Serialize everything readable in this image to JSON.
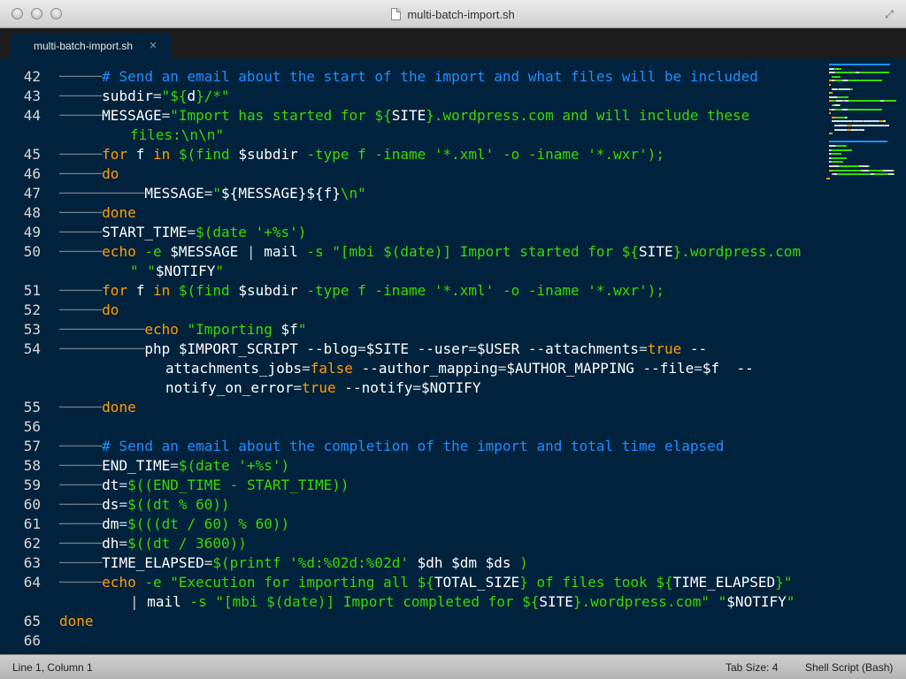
{
  "window": {
    "title": "multi-batch-import.sh"
  },
  "tabs": [
    {
      "label": "multi-batch-import.sh",
      "close_glyph": "×"
    }
  ],
  "editor": {
    "lines": [
      {
        "n": "42",
        "indent": 1,
        "wrap": false,
        "tokens": [
          [
            "c-cmt",
            "# Send an email about the start of the import and what files will be included"
          ]
        ]
      },
      {
        "n": "43",
        "indent": 1,
        "wrap": false,
        "tokens": [
          [
            "c-var",
            "subdir"
          ],
          [
            "c-op",
            "="
          ],
          [
            "c-str",
            "\"${"
          ],
          [
            "c-var",
            "d"
          ],
          [
            "c-str",
            "}/*\""
          ]
        ]
      },
      {
        "n": "44",
        "indent": 1,
        "wrap": false,
        "tokens": [
          [
            "c-var",
            "MESSAGE"
          ],
          [
            "c-op",
            "="
          ],
          [
            "c-str",
            "\"Import has started for ${"
          ],
          [
            "c-var",
            "SITE"
          ],
          [
            "c-str",
            "}.wordpress.com and will include these"
          ]
        ]
      },
      {
        "n": "",
        "indent": 2,
        "wrap": true,
        "tokens": [
          [
            "c-str",
            "files:\\n\\n\""
          ]
        ]
      },
      {
        "n": "45",
        "indent": 1,
        "wrap": false,
        "tokens": [
          [
            "c-kw",
            "for"
          ],
          [
            "c-var",
            " f "
          ],
          [
            "c-kw",
            "in"
          ],
          [
            "c-str",
            " $(find "
          ],
          [
            "c-var",
            "$subdir"
          ],
          [
            "c-str",
            " -type f -iname '*.xml' -o -iname '*.wxr');"
          ]
        ]
      },
      {
        "n": "46",
        "indent": 1,
        "wrap": false,
        "tokens": [
          [
            "c-kw",
            "do"
          ]
        ]
      },
      {
        "n": "47",
        "indent": 2,
        "wrap": false,
        "tokens": [
          [
            "c-var",
            "MESSAGE"
          ],
          [
            "c-op",
            "="
          ],
          [
            "c-str",
            "\""
          ],
          [
            "c-var",
            "${MESSAGE}${f}"
          ],
          [
            "c-str",
            "\\n\""
          ]
        ]
      },
      {
        "n": "48",
        "indent": 1,
        "wrap": false,
        "tokens": [
          [
            "c-kw",
            "done"
          ]
        ]
      },
      {
        "n": "49",
        "indent": 1,
        "wrap": false,
        "tokens": [
          [
            "c-var",
            "START_TIME"
          ],
          [
            "c-op",
            "="
          ],
          [
            "c-str",
            "$(date '+%s')"
          ]
        ]
      },
      {
        "n": "50",
        "indent": 1,
        "wrap": false,
        "tokens": [
          [
            "c-kw",
            "echo"
          ],
          [
            "c-str",
            " -e "
          ],
          [
            "c-var",
            "$MESSAGE"
          ],
          [
            "c-op",
            " | "
          ],
          [
            "c-var",
            "mail"
          ],
          [
            "c-str",
            " -s \"[mbi $(date)] Import started for ${"
          ],
          [
            "c-var",
            "SITE"
          ],
          [
            "c-str",
            "}.wordpress.com"
          ]
        ]
      },
      {
        "n": "",
        "indent": 2,
        "wrap": true,
        "tokens": [
          [
            "c-str",
            "\" \""
          ],
          [
            "c-var",
            "$NOTIFY"
          ],
          [
            "c-str",
            "\""
          ]
        ]
      },
      {
        "n": "51",
        "indent": 1,
        "wrap": false,
        "tokens": [
          [
            "c-kw",
            "for"
          ],
          [
            "c-var",
            " f "
          ],
          [
            "c-kw",
            "in"
          ],
          [
            "c-str",
            " $(find "
          ],
          [
            "c-var",
            "$subdir"
          ],
          [
            "c-str",
            " -type f -iname '*.xml' -o -iname '*.wxr');"
          ]
        ]
      },
      {
        "n": "52",
        "indent": 1,
        "wrap": false,
        "tokens": [
          [
            "c-kw",
            "do"
          ]
        ]
      },
      {
        "n": "53",
        "indent": 2,
        "wrap": false,
        "tokens": [
          [
            "c-kw",
            "echo"
          ],
          [
            "c-str",
            " \"Importing "
          ],
          [
            "c-var",
            "$f"
          ],
          [
            "c-str",
            "\""
          ]
        ]
      },
      {
        "n": "54",
        "indent": 2,
        "wrap": false,
        "tokens": [
          [
            "c-var",
            "php $IMPORT_SCRIPT --blog"
          ],
          [
            "c-op",
            "="
          ],
          [
            "c-var",
            "$SITE --user"
          ],
          [
            "c-op",
            "="
          ],
          [
            "c-var",
            "$USER --attachments"
          ],
          [
            "c-op",
            "="
          ],
          [
            "c-bool",
            "true"
          ],
          [
            "c-var",
            " --"
          ]
        ]
      },
      {
        "n": "",
        "indent": 3,
        "wrap": true,
        "tokens": [
          [
            "c-var",
            "attachments_jobs"
          ],
          [
            "c-op",
            "="
          ],
          [
            "c-bool",
            "false"
          ],
          [
            "c-var",
            " --author_mapping"
          ],
          [
            "c-op",
            "="
          ],
          [
            "c-var",
            "$AUTHOR_MAPPING --file"
          ],
          [
            "c-op",
            "="
          ],
          [
            "c-var",
            "$f  --"
          ]
        ]
      },
      {
        "n": "",
        "indent": 3,
        "wrap": true,
        "tokens": [
          [
            "c-var",
            "notify_on_error"
          ],
          [
            "c-op",
            "="
          ],
          [
            "c-bool",
            "true"
          ],
          [
            "c-var",
            " --notify"
          ],
          [
            "c-op",
            "="
          ],
          [
            "c-var",
            "$NOTIFY"
          ]
        ]
      },
      {
        "n": "55",
        "indent": 1,
        "wrap": false,
        "tokens": [
          [
            "c-kw",
            "done"
          ]
        ]
      },
      {
        "n": "56",
        "indent": 0,
        "wrap": false,
        "tokens": []
      },
      {
        "n": "57",
        "indent": 1,
        "wrap": false,
        "tokens": [
          [
            "c-cmt",
            "# Send an email about the completion of the import and total time elapsed"
          ]
        ]
      },
      {
        "n": "58",
        "indent": 1,
        "wrap": false,
        "tokens": [
          [
            "c-var",
            "END_TIME"
          ],
          [
            "c-op",
            "="
          ],
          [
            "c-str",
            "$(date '+%s')"
          ]
        ]
      },
      {
        "n": "59",
        "indent": 1,
        "wrap": false,
        "tokens": [
          [
            "c-var",
            "dt"
          ],
          [
            "c-op",
            "="
          ],
          [
            "c-str",
            "$((END_TIME - START_TIME))"
          ]
        ]
      },
      {
        "n": "60",
        "indent": 1,
        "wrap": false,
        "tokens": [
          [
            "c-var",
            "ds"
          ],
          [
            "c-op",
            "="
          ],
          [
            "c-str",
            "$((dt % 60))"
          ]
        ]
      },
      {
        "n": "61",
        "indent": 1,
        "wrap": false,
        "tokens": [
          [
            "c-var",
            "dm"
          ],
          [
            "c-op",
            "="
          ],
          [
            "c-str",
            "$(((dt / 60) % 60))"
          ]
        ]
      },
      {
        "n": "62",
        "indent": 1,
        "wrap": false,
        "tokens": [
          [
            "c-var",
            "dh"
          ],
          [
            "c-op",
            "="
          ],
          [
            "c-str",
            "$((dt / 3600))"
          ]
        ]
      },
      {
        "n": "63",
        "indent": 1,
        "wrap": false,
        "tokens": [
          [
            "c-var",
            "TIME_ELAPSED"
          ],
          [
            "c-op",
            "="
          ],
          [
            "c-str",
            "$(printf '%d:%02d:%02d' "
          ],
          [
            "c-var",
            "$dh $dm $ds"
          ],
          [
            "c-str",
            " )"
          ]
        ]
      },
      {
        "n": "64",
        "indent": 1,
        "wrap": false,
        "tokens": [
          [
            "c-kw",
            "echo"
          ],
          [
            "c-str",
            " -e \"Execution for importing all ${"
          ],
          [
            "c-var",
            "TOTAL_SIZE"
          ],
          [
            "c-str",
            "} of files took ${"
          ],
          [
            "c-var",
            "TIME_ELAPSED"
          ],
          [
            "c-str",
            "}\""
          ]
        ]
      },
      {
        "n": "",
        "indent": 2,
        "wrap": true,
        "tokens": [
          [
            "c-op",
            "| "
          ],
          [
            "c-var",
            "mail"
          ],
          [
            "c-str",
            " -s \"[mbi $(date)] Import completed for ${"
          ],
          [
            "c-var",
            "SITE"
          ],
          [
            "c-str",
            "}.wordpress.com\" \""
          ],
          [
            "c-var",
            "$NOTIFY"
          ],
          [
            "c-str",
            "\""
          ]
        ]
      },
      {
        "n": "65",
        "indent": 0,
        "wrap": false,
        "tokens": [
          [
            "c-kw",
            "done"
          ]
        ]
      },
      {
        "n": "66",
        "indent": 0,
        "wrap": false,
        "tokens": []
      }
    ]
  },
  "status": {
    "position": "Line 1, Column 1",
    "tab_size": "Tab Size: 4",
    "syntax": "Shell Script (Bash)"
  }
}
